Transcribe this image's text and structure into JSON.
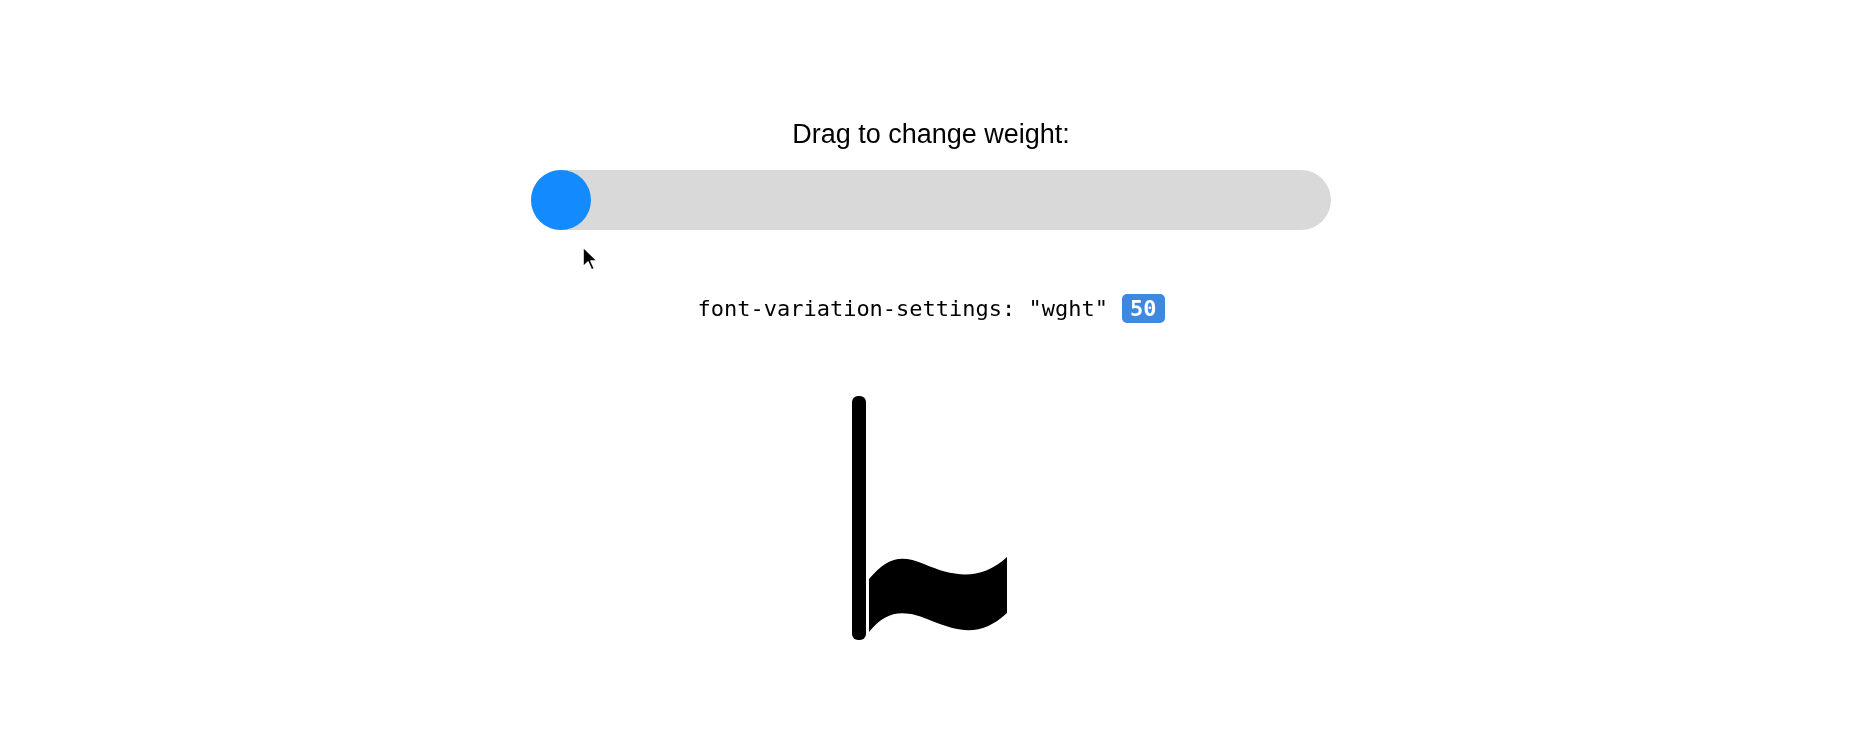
{
  "heading": "Drag to change weight:",
  "slider": {
    "level": 0
  },
  "code": {
    "text": "font-variation-settings: \"wght\"",
    "value": "50"
  }
}
